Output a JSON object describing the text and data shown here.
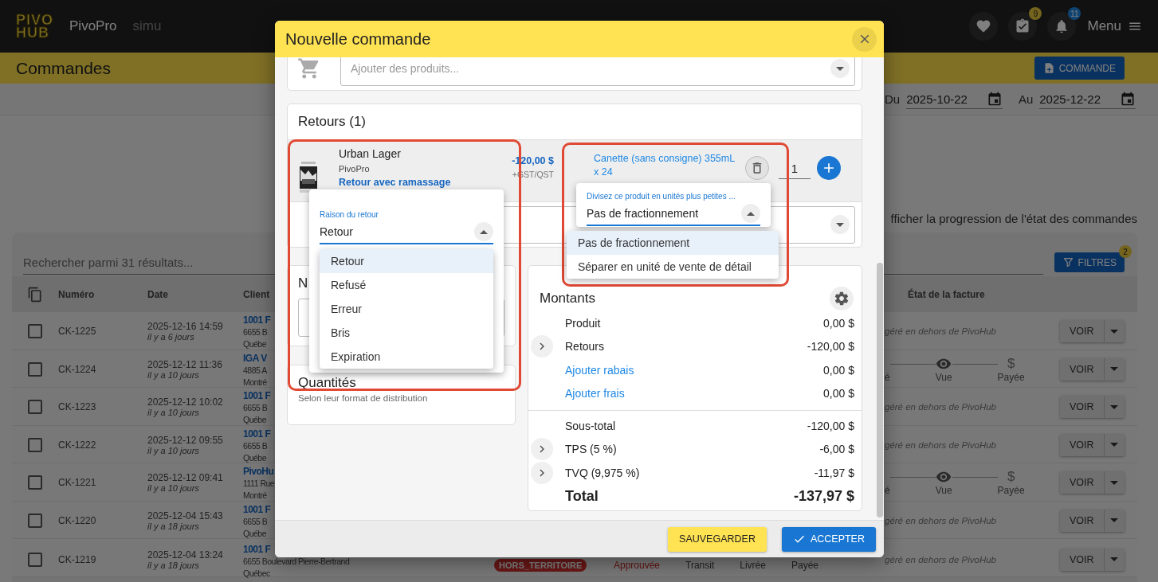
{
  "app_bar": {
    "logo_top": "PIVO",
    "logo_bottom": "HUB",
    "brand": "PivoPro",
    "environment": "simu",
    "tasks_badge": "9",
    "notifications_badge": "11",
    "menu_label": "Menu"
  },
  "page_header": {
    "title": "Commandes",
    "new_button": "COMMANDE"
  },
  "date_filter": {
    "from_label": "Du",
    "from_value": "2025-10-22",
    "to_label": "Au",
    "to_value": "2025-12-22"
  },
  "progress_toggle_label": "fficher la progression de l'état des commandes",
  "orders": {
    "search_placeholder": "Rechercher parmi 31 résultats...",
    "filters_button": "FILTRES",
    "filters_badge": "2",
    "columns": [
      "Numéro",
      "Date",
      "Client",
      "État de la facture"
    ],
    "rows": [
      {
        "checked": false,
        "number": "CK-1225",
        "date": "2025-12-16 14:59",
        "ago": "il y a 6 jours",
        "client": [
          "1001 F",
          "6655 B",
          "Québe"
        ],
        "invoice": {
          "kind": "external",
          "text": "géré en dehors de PivoHub"
        },
        "action": "VOIR"
      },
      {
        "checked": false,
        "number": "CK-1224",
        "date": "2025-12-12 11:36",
        "ago": "il y a 10 jours",
        "client": [
          "IGA V",
          "4885 A",
          "Montré"
        ],
        "invoice": {
          "kind": "progress",
          "steps": [
            {
              "kind": "sent",
              "label": "é"
            },
            {
              "kind": "seen",
              "label": "Vue"
            },
            {
              "kind": "paid",
              "symbol": "$",
              "label": "Payée"
            }
          ]
        },
        "action": "VOIR"
      },
      {
        "checked": false,
        "number": "CK-1223",
        "date": "2025-12-12 10:02",
        "ago": "il y a 10 jours",
        "client": [
          "1001 F",
          "6655 B",
          "Québe"
        ],
        "invoice": {
          "kind": "external",
          "text": "géré en dehors de PivoHub"
        },
        "action": "VOIR"
      },
      {
        "checked": false,
        "number": "CK-1222",
        "date": "2025-12-12 09:55",
        "ago": "il y a 10 jours",
        "client": [
          "1001 F",
          "6655 B",
          "Québe"
        ],
        "invoice": {
          "kind": "external",
          "text": "géré en dehors de PivoHub"
        },
        "action": "VOIR"
      },
      {
        "checked": false,
        "number": "CK-1221",
        "date": "2025-12-12 09:41",
        "ago": "il y a 10 jours",
        "client": [
          "PivoHu",
          "1111 Rue",
          "Montré"
        ],
        "invoice": {
          "kind": "progress",
          "steps": [
            {
              "kind": "sent",
              "label": "é"
            },
            {
              "kind": "seen",
              "label": "Vue"
            },
            {
              "kind": "paid",
              "symbol": "$",
              "label": "Payée"
            }
          ]
        },
        "action": "VOIR"
      },
      {
        "checked": false,
        "number": "CK-1220",
        "date": "2025-12-04 15:43",
        "ago": "il y a 18 jours",
        "client": [
          "1001 F",
          "6655 B",
          "Québe"
        ],
        "invoice": {
          "kind": "external",
          "text": "géré en dehors de PivoHub"
        },
        "action": "VOIR"
      },
      {
        "checked": false,
        "number": "CK-1219",
        "date": "2025-12-04 13:24",
        "ago": "il y a 18 jours",
        "client": [
          "1001 F",
          "6655 Boulevard Pierre-Bertrand",
          "Québec"
        ],
        "status_badge": "HORS_TERRITOIRE",
        "order_progress": [
          {
            "label": "Approuvée",
            "current": true
          },
          {
            "label": "Transit",
            "current": false
          },
          {
            "label": "Livrée",
            "current": false
          },
          {
            "label": "Payée",
            "current": false
          }
        ],
        "invoice": {
          "kind": "external",
          "text": "géré en dehors de PivoHub"
        },
        "action": "VOIR"
      }
    ]
  },
  "modal": {
    "title": "Nouvelle commande",
    "product_search": {
      "placeholder": "Ajouter des produits..."
    },
    "returns": {
      "title": "Retours (1)",
      "items": [
        {
          "name": "Urban Lager",
          "brand": "PivoPro",
          "return_type": "Retour avec ramassage",
          "price": "-120,00 $",
          "tax_note": "+GST/QST",
          "format": "Canette (sans consigne) 355mL x 24",
          "quantity": "1"
        }
      ]
    },
    "notes": {
      "title": "N"
    },
    "quantities": {
      "title": "Quantités",
      "subtitle": "Selon leur format de distribution"
    },
    "amounts": {
      "title": "Montants",
      "rows": [
        {
          "kind": "plain",
          "label": "Produit",
          "value": "0,00 $"
        },
        {
          "kind": "expandable",
          "label": "Retours",
          "value": "-120,00 $"
        },
        {
          "kind": "link",
          "label": "Ajouter rabais",
          "value": "0,00 $"
        },
        {
          "kind": "link",
          "label": "Ajouter frais",
          "value": "0,00 $"
        }
      ],
      "summary_rows": [
        {
          "kind": "plain",
          "label": "Sous-total",
          "value": "-120,00 $"
        },
        {
          "kind": "expandable",
          "label": "TPS (5 %)",
          "value": "-6,00 $"
        },
        {
          "kind": "expandable",
          "label": "TVQ (9,975 %)",
          "value": "-11,97 $"
        }
      ],
      "total": {
        "label": "Total",
        "value": "-137,97 $"
      }
    },
    "save_button": "SAUVEGARDER",
    "accept_button": "ACCEPTER",
    "return_reason_menu": {
      "label": "Raison du retour",
      "value": "Retour",
      "options": [
        {
          "label": "Retour",
          "selected": true
        },
        {
          "label": "Refusé",
          "selected": false
        },
        {
          "label": "Erreur",
          "selected": false
        },
        {
          "label": "Bris",
          "selected": false
        },
        {
          "label": "Expiration",
          "selected": false
        }
      ]
    },
    "split_menu": {
      "label": "Divisez ce produit en unités plus petites ...",
      "value": "Pas de fractionnement",
      "options": [
        {
          "label": "Pas de fractionnement",
          "selected": true
        },
        {
          "label": "Séparer en unité de vente de détail",
          "selected": false
        }
      ]
    }
  }
}
